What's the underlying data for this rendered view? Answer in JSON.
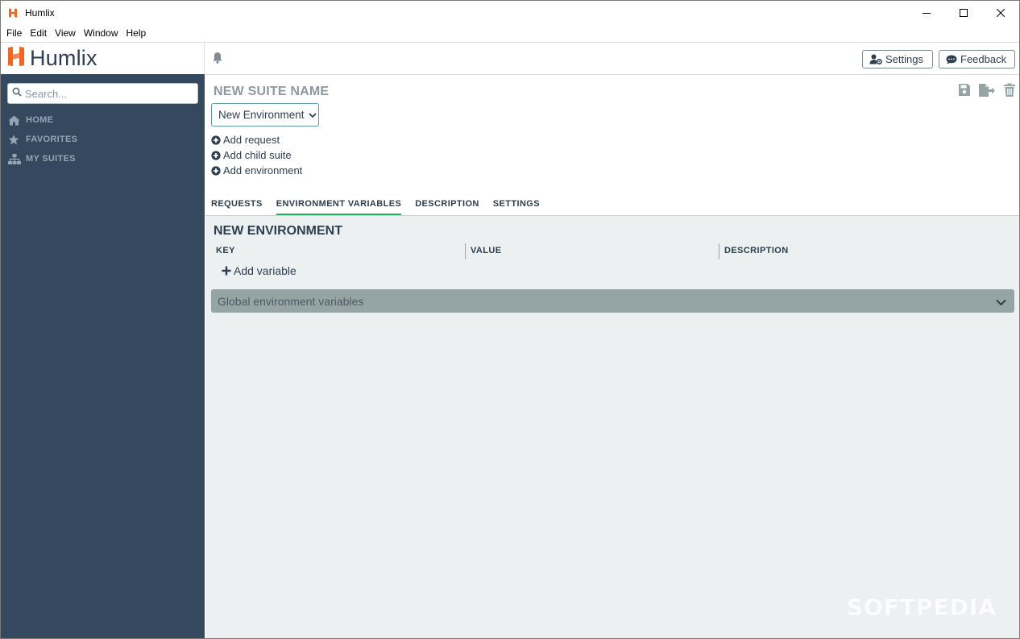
{
  "window": {
    "title": "Humlix",
    "controls": [
      "minimize-icon",
      "maximize-icon",
      "close-icon"
    ]
  },
  "menubar": {
    "items": [
      "File",
      "Edit",
      "View",
      "Window",
      "Help"
    ]
  },
  "brand": {
    "name": "Humlix",
    "accent_color": "#f26522"
  },
  "sidebar": {
    "bg_color": "#34495e",
    "search_placeholder": "Search...",
    "nav": [
      {
        "label": "HOME",
        "icon": "home-icon"
      },
      {
        "label": "FAVORITES",
        "icon": "star-icon"
      },
      {
        "label": "MY SUITES",
        "icon": "sitemap-icon"
      }
    ]
  },
  "topbar": {
    "settings_label": "Settings",
    "feedback_label": "Feedback"
  },
  "suite": {
    "name_placeholder": "NEW SUITE NAME",
    "environment_selected": "New Environment",
    "add_request": "Add request",
    "add_child_suite": "Add child suite",
    "add_environment": "Add environment",
    "actions": [
      "save-icon",
      "export-icon",
      "trash-icon"
    ]
  },
  "tabs": {
    "items": [
      "REQUESTS",
      "ENVIRONMENT VARIABLES",
      "DESCRIPTION",
      "SETTINGS"
    ],
    "active": "ENVIRONMENT VARIABLES",
    "active_color": "#27ae60"
  },
  "env_panel": {
    "heading": "NEW ENVIRONMENT",
    "columns": [
      "KEY",
      "VALUE",
      "DESCRIPTION"
    ],
    "add_variable": "Add variable",
    "global_label": "Global environment variables"
  },
  "watermark": "SOFTPEDIA"
}
